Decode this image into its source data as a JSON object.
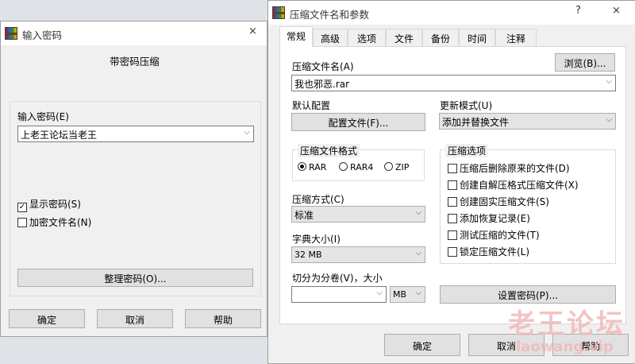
{
  "left_dialog": {
    "title": "输入密码",
    "close": "×",
    "heading": "带密码压缩",
    "password_label": "输入密码(E)",
    "password_value": "上老王论坛当老王",
    "show_password": {
      "label": "显示密码(S)",
      "checked": true
    },
    "encrypt_names": {
      "label": "加密文件名(N)",
      "checked": false
    },
    "organize_btn": "整理密码(O)...",
    "ok": "确定",
    "cancel": "取消",
    "help": "帮助"
  },
  "right_dialog": {
    "title": "压缩文件名和参数",
    "help_btn": "?",
    "close": "×",
    "tabs": [
      "常规",
      "高级",
      "选项",
      "文件",
      "备份",
      "时间",
      "注释"
    ],
    "archive_name_label": "压缩文件名(A)",
    "browse_btn": "浏览(B)...",
    "archive_name_value": "我也邪恶.rar",
    "default_profile_label": "默认配置",
    "profile_btn": "配置文件(F)...",
    "update_mode_label": "更新模式(U)",
    "update_mode_value": "添加并替换文件",
    "format_group": "压缩文件格式",
    "formats": [
      {
        "label": "RAR",
        "selected": true
      },
      {
        "label": "RAR4",
        "selected": false
      },
      {
        "label": "ZIP",
        "selected": false
      }
    ],
    "method_label": "压缩方式(C)",
    "method_value": "标准",
    "dict_label": "字典大小(I)",
    "dict_value": "32 MB",
    "split_label": "切分为分卷(V)，大小",
    "split_value": "",
    "split_unit": "MB",
    "options_group": "压缩选项",
    "options": [
      "压缩后删除原来的文件(D)",
      "创建自解压格式压缩文件(X)",
      "创建固实压缩文件(S)",
      "添加恢复记录(E)",
      "测试压缩的文件(T)",
      "锁定压缩文件(L)"
    ],
    "set_password_btn": "设置密码(P)...",
    "ok": "确定",
    "cancel": "取消",
    "help": "帮助"
  },
  "watermark": {
    "text": "老王论坛",
    "subtext": "laowang.vip",
    "color": "#f2b9b9"
  },
  "colors": {
    "dialog_bg": "#f0f0f0",
    "title_bg": "#ffffff"
  }
}
